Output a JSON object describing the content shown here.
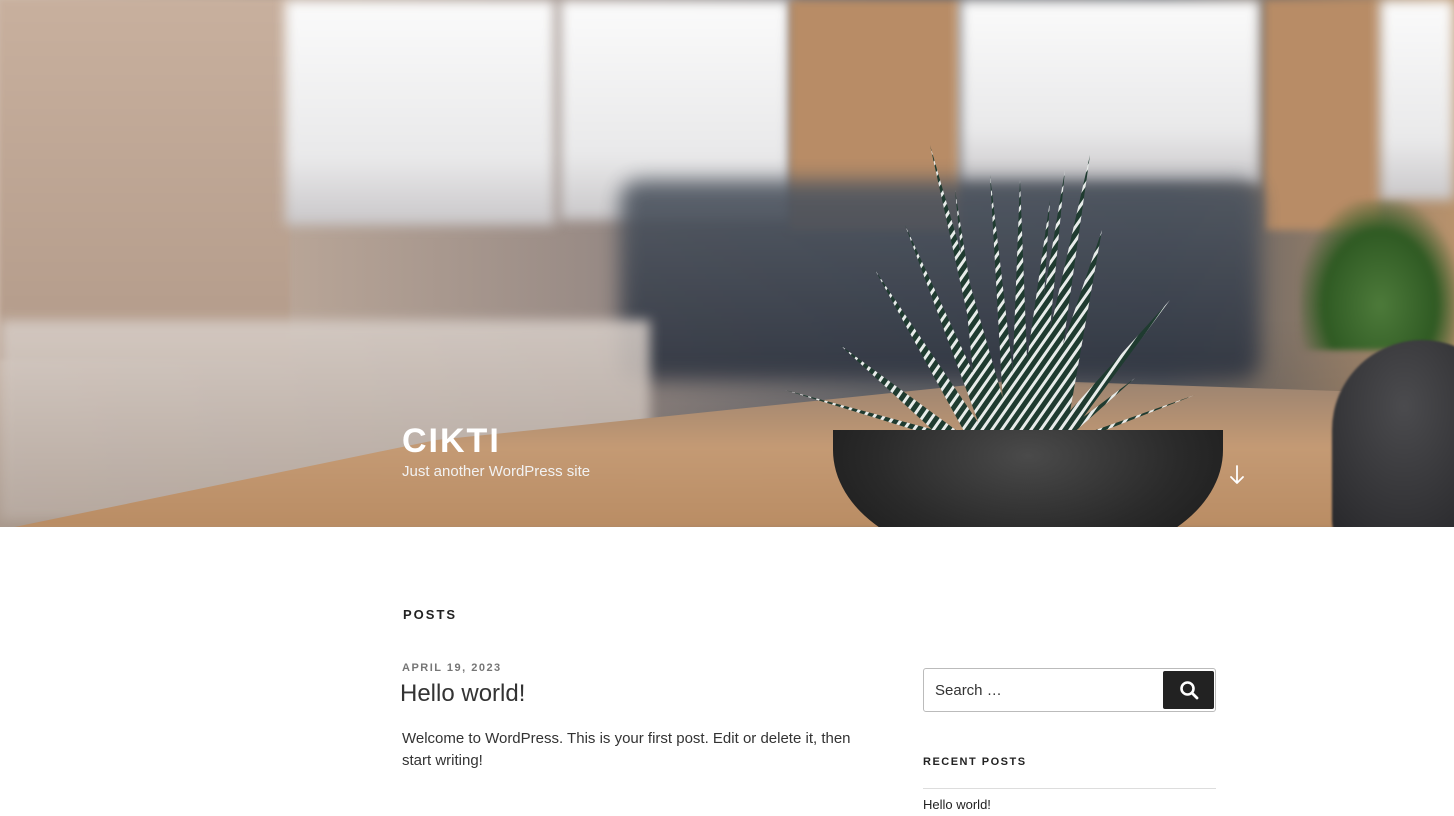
{
  "site": {
    "title": "CIKTI",
    "description": "Just another WordPress site"
  },
  "header": {
    "scroll_icon": "arrow-down-icon"
  },
  "main": {
    "page_header": "POSTS",
    "posts": [
      {
        "date": "APRIL 19, 2023",
        "title": "Hello world!",
        "excerpt": "Welcome to WordPress. This is your first post. Edit or delete it, then start writing!"
      }
    ]
  },
  "sidebar": {
    "search": {
      "placeholder": "Search …",
      "icon": "search-icon"
    },
    "recent_posts": {
      "title": "RECENT POSTS",
      "items": [
        "Hello world!"
      ]
    }
  }
}
